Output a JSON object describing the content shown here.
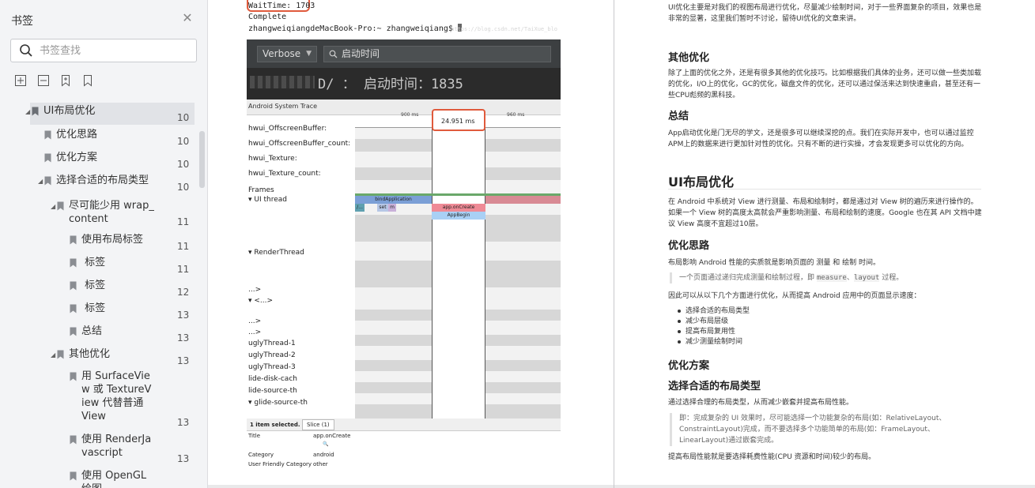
{
  "sidebar": {
    "title": "书签",
    "search_placeholder": "书签查找",
    "items": [
      {
        "label": "UI布局优化",
        "page": "10",
        "level": 0,
        "expanded": true,
        "selected": true
      },
      {
        "label": "优化思路",
        "page": "10",
        "level": 1
      },
      {
        "label": "优化方案",
        "page": "10",
        "level": 1
      },
      {
        "label": "选择合适的布局类型",
        "page": "10",
        "level": 1,
        "expanded": true
      },
      {
        "label": "尽可能少用 wrap_\ncontent",
        "page": "11",
        "level": 2,
        "expanded": true
      },
      {
        "label": "使用布局标签",
        "page": "11",
        "level": 3
      },
      {
        "label": " 标签",
        "page": "11",
        "level": 3
      },
      {
        "label": " 标签",
        "page": "12",
        "level": 3
      },
      {
        "label": " 标签",
        "page": "13",
        "level": 3
      },
      {
        "label": "总结",
        "page": "13",
        "level": 3
      },
      {
        "label": "其他优化",
        "page": "13",
        "level": 2,
        "expanded": true
      },
      {
        "label": "用 SurfaceVie\nw 或 TextureV\niew 代替普通\nView",
        "page": "13",
        "level": 3
      },
      {
        "label": "使用 RenderJa\nvascript",
        "page": "13",
        "level": 3
      },
      {
        "label": "使用 OpenGL\n绘图",
        "page": "",
        "level": 3
      }
    ]
  },
  "page1": {
    "terminal": {
      "line1": "WaitTime: 1703",
      "line2": "Complete",
      "line3": "zhangweiqiangdeMacBook-Pro:~ zhangweiqiang$ ",
      "watermark": "https://blog.csdn.net/TaiXue_blo"
    },
    "logcat": {
      "level": "Verbose",
      "query": "启动时间",
      "line": "D/ ： 启动时间：1835"
    },
    "trace": {
      "header": "Android System Trace",
      "ruler_ticks": [
        "900 ms",
        "960 ms"
      ],
      "measure": "24.951 ms",
      "tracks": [
        "hwui_OffscreenBuffer:",
        "hwui_OffscreenBuffer_count:",
        "hwui_Texture:",
        "hwui_Texture_count:",
        "Frames",
        "▾ UI thread",
        "▾ RenderThread",
        "...>",
        "▾ <...>",
        "...>",
        "...>",
        "uglyThread-1",
        "uglyThread-2",
        "uglyThread-3",
        "lide-disk-cach",
        "lide-source-th",
        "▾ glide-source-th"
      ],
      "slices": {
        "a": "bindApplication",
        "b": "app.onCreate",
        "c": "AppBegin",
        "d": "set",
        "e": "m",
        "f": "/..."
      }
    },
    "info": {
      "selected": "1 item selected.",
      "tab": "Slice (1)",
      "rows": [
        {
          "k": "Title",
          "v": "app.onCreate"
        },
        {
          "k": "Category",
          "v": "android"
        },
        {
          "k": "User Friendly Category",
          "v": "other"
        }
      ]
    }
  },
  "page2": {
    "intro": "UI优化主要是对我们的视图布局进行优化，尽量减少绘制时间，对于一些界面复杂的项目，效果也是非常的显著，这里我们暂时不讨论，留待UI优化的文章来讲。",
    "h_other": "其他优化",
    "p_other": "除了上面的优化之外，还是有很多其他的优化技巧。比如根据我们具体的业务，还可以做一些类加载的优化，I/O上的优化，GC的优化，磁盘文件的优化，还可以通过保活来达到快速重启，甚至还有一些CPU彪频的黑科技。",
    "h_summary": "总结",
    "p_summary": "App启动优化是门无尽的学文，还是很多可以继续深挖的点。我们在实际开发中，也可以通过监控APM上的数据来进行更加针对性的优化。只有不断的进行实操，才会发现更多可以优化的方向。",
    "h_ui": "UI布局优化",
    "p_ui": "在 Android 中系统对 View 进行测量、布局和绘制时，都是通过对 View 树的遍历来进行操作的。如果一个 View 树的高度太高就会严重影响测量、布局和绘制的速度。Google 也在其 API 文档中建议 View 高度不宜超过10层。",
    "h_idea": "优化思路",
    "p_idea": "布局影响 Android 性能的实质就是影响页面的 测量 和 绘制 时间。",
    "q_idea_pre": "一个页面通过递归完成测量和绘制过程，即 ",
    "q_idea_code1": "measure",
    "q_idea_mid": "、",
    "q_idea_code2": "layout",
    "q_idea_post": " 过程。",
    "p_aspects": "因此可以从以下几个方面进行优化，从而提高 Android 应用中的页面显示速度：",
    "list": [
      "选择合适的布局类型",
      "减少布局层级",
      "提高布局复用性",
      "减少测量绘制时间"
    ],
    "h_plan": "优化方案",
    "h_choose": "选择合适的布局类型",
    "p_choose": "通过选择合理的布局类型，从而减少嵌套并提高布局性能。",
    "q_choose": "即：完成复杂的 UI 效果时，尽可能选择一个功能复杂的布局(如：RelativeLayout、ConstraintLayout)完成，而不要选择多个功能简单的布局(如：FrameLayout、LinearLayout)通过嵌套完成。",
    "p_last": "提高布局性能就是要选择耗费性能(CPU 资源和时间)较少的布局。"
  }
}
